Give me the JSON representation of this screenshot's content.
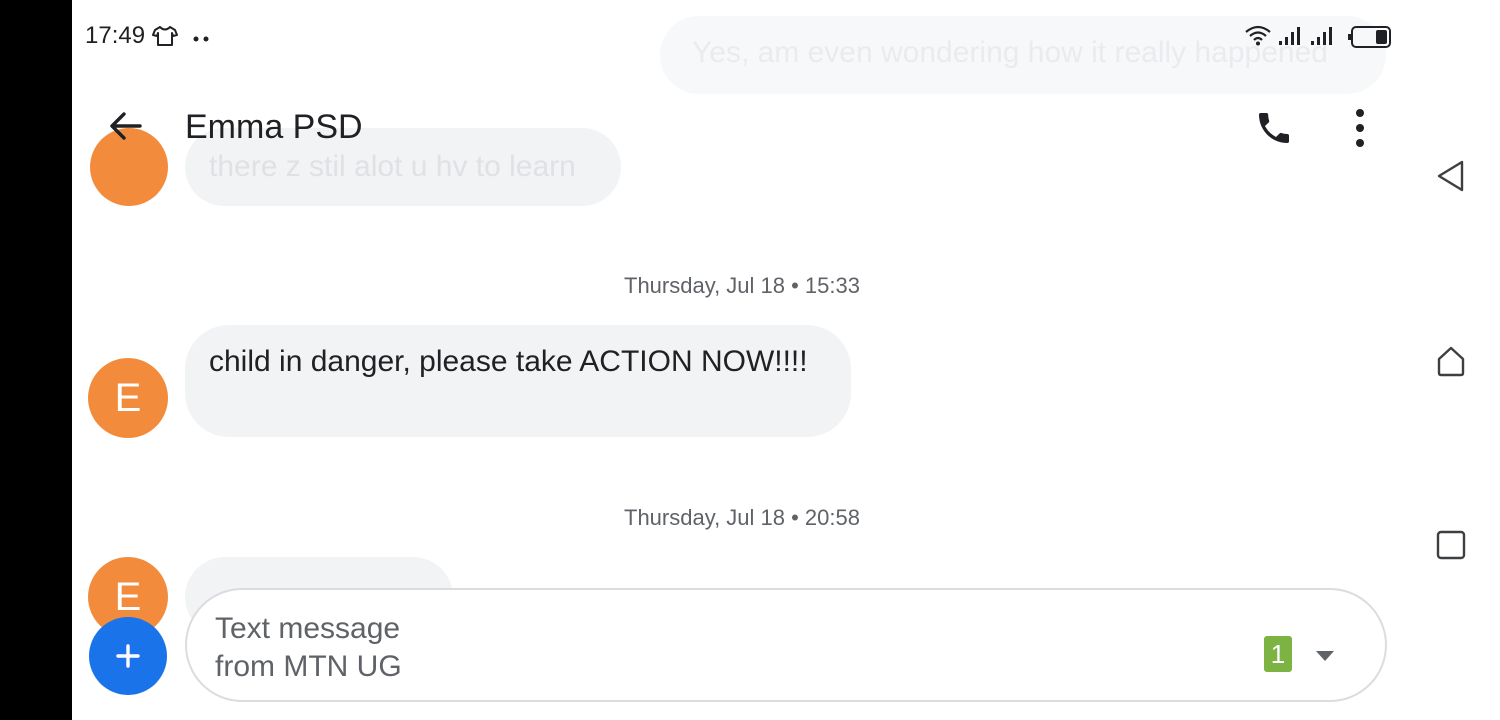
{
  "status_bar": {
    "time": "17:49",
    "icons": [
      "shirt-icon",
      "more-dots-icon",
      "wifi-icon",
      "signal-icon",
      "signal-icon",
      "battery-icon"
    ]
  },
  "faded_messages": [
    {
      "text": "Yes, am even wondering how it really happened"
    },
    {
      "text": "there z stil alot u hv to learn"
    }
  ],
  "header": {
    "contact_name": "Emma PSD",
    "icons": [
      "arrow-back-icon",
      "phone-icon",
      "more-vert-icon"
    ]
  },
  "thread": [
    {
      "timestamp": "Thursday, Jul 18 • 15:33",
      "avatar_letter": "E",
      "message": "child in danger, please take ACTION NOW!!!!"
    },
    {
      "timestamp": "Thursday, Jul 18 • 20:58",
      "avatar_letter": "E",
      "message": ""
    }
  ],
  "composer": {
    "placeholder_line1": "Text message",
    "placeholder_line2": "from MTN UG",
    "sim_slot": "1"
  },
  "nav_bar": {
    "icons": [
      "nav-back-icon",
      "nav-home-icon",
      "nav-recents-icon"
    ]
  },
  "colors": {
    "avatar": "#f28c3c",
    "bubble": "#f1f3f4",
    "fab": "#1a73e8",
    "sim_badge": "#7cb342"
  }
}
